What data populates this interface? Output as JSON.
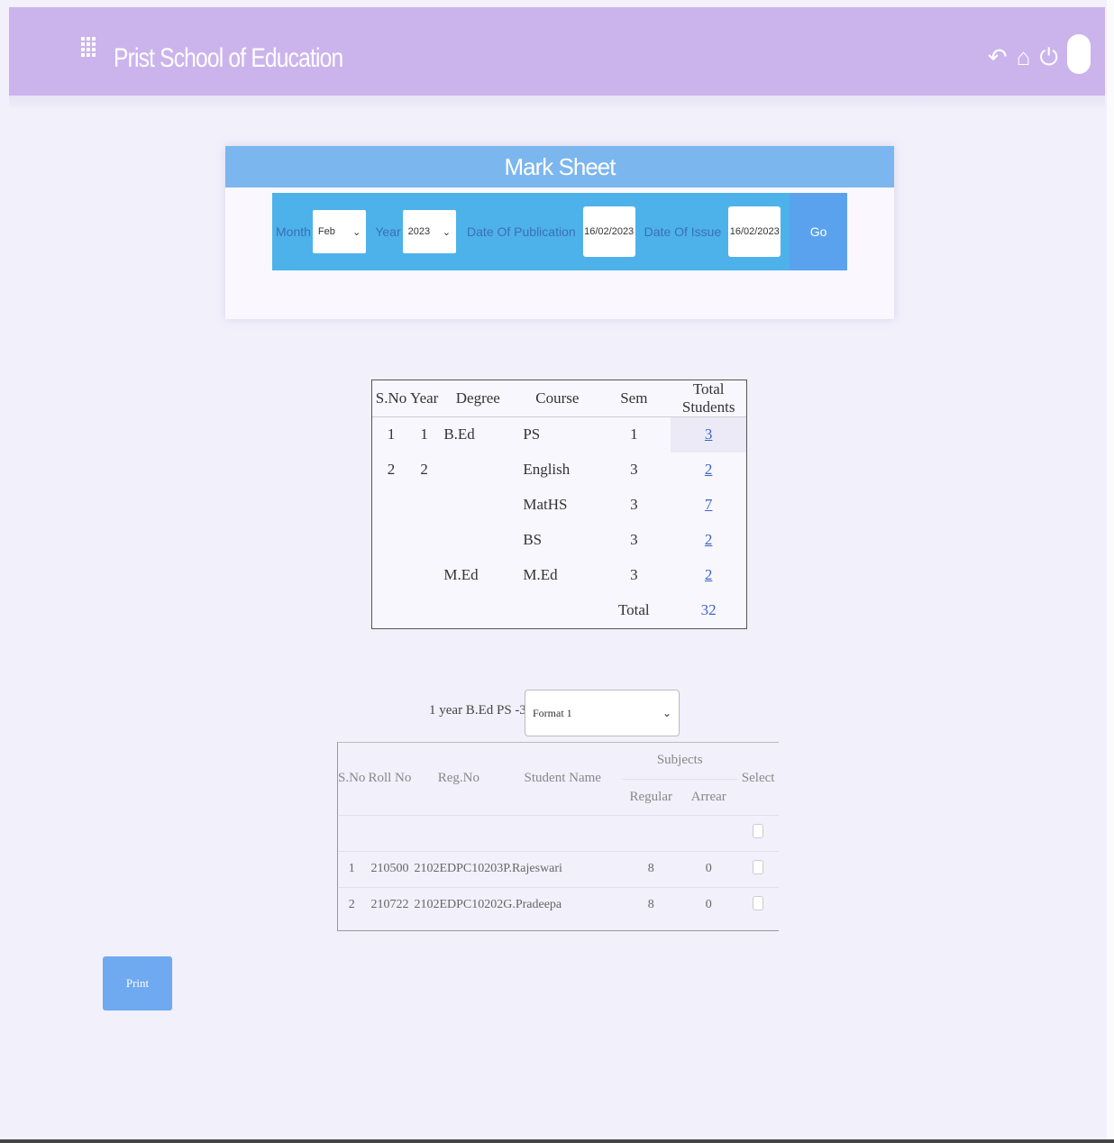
{
  "header": {
    "title": "Prist School of Education",
    "icons": [
      "menu-grid-icon",
      "back-icon",
      "home-icon",
      "power-icon",
      "avatar"
    ]
  },
  "card": {
    "title": "Mark Sheet",
    "filters": {
      "month_label": "Month",
      "month_value": "Feb",
      "year_label": "Year",
      "year_value": "2023",
      "publication_label": "Date Of Publication",
      "publication_value": "16/02/2023",
      "issue_label": "Date Of Issue",
      "issue_value": "16/02/2023",
      "go_label": "Go"
    }
  },
  "summary": {
    "headers": [
      "S.No",
      "Year",
      "Degree",
      "Course",
      "Sem",
      "Total Students"
    ],
    "rows": [
      {
        "sno": "1",
        "year": "1",
        "degree": "B.Ed",
        "course": "PS",
        "sem": "1",
        "total": "3"
      },
      {
        "sno": "2",
        "year": "2",
        "degree": "",
        "course": "English",
        "sem": "3",
        "total": "2"
      },
      {
        "sno": "",
        "year": "",
        "degree": "",
        "course": "MatHS",
        "sem": "3",
        "total": "7"
      },
      {
        "sno": "",
        "year": "",
        "degree": "",
        "course": "BS",
        "sem": "3",
        "total": "2"
      },
      {
        "sno": "",
        "year": "",
        "degree": "M.Ed",
        "course": "M.Ed",
        "sem": "3",
        "total": "2"
      }
    ],
    "total_label": "Total",
    "total_value": "32"
  },
  "students": {
    "group_label": "1 year B.Ed PS -3",
    "format_value": "Format 1",
    "headers": {
      "sno": "S.No",
      "roll": "Roll No",
      "reg": "Reg.No",
      "name": "Student Name",
      "subjects": "Subjects",
      "regular": "Regular",
      "arrear": "Arrear",
      "select": "Select"
    },
    "rows": [
      {
        "sno": "1",
        "roll": "210500",
        "reg": "2102EDPC10203",
        "name": "P.Rajeswari",
        "regular": "8",
        "arrear": "0"
      },
      {
        "sno": "2",
        "roll": "210722",
        "reg": "2102EDPC10202",
        "name": "G.Pradeepa",
        "regular": "8",
        "arrear": "0"
      }
    ]
  },
  "print_label": "Print",
  "colors": {
    "header_bg": "#cbb4ec",
    "card_head_bg": "#7bb6ef",
    "filter_bar_bg": "#4db2ea",
    "link": "#3a63c8",
    "print_btn": "#6fa9ef"
  }
}
